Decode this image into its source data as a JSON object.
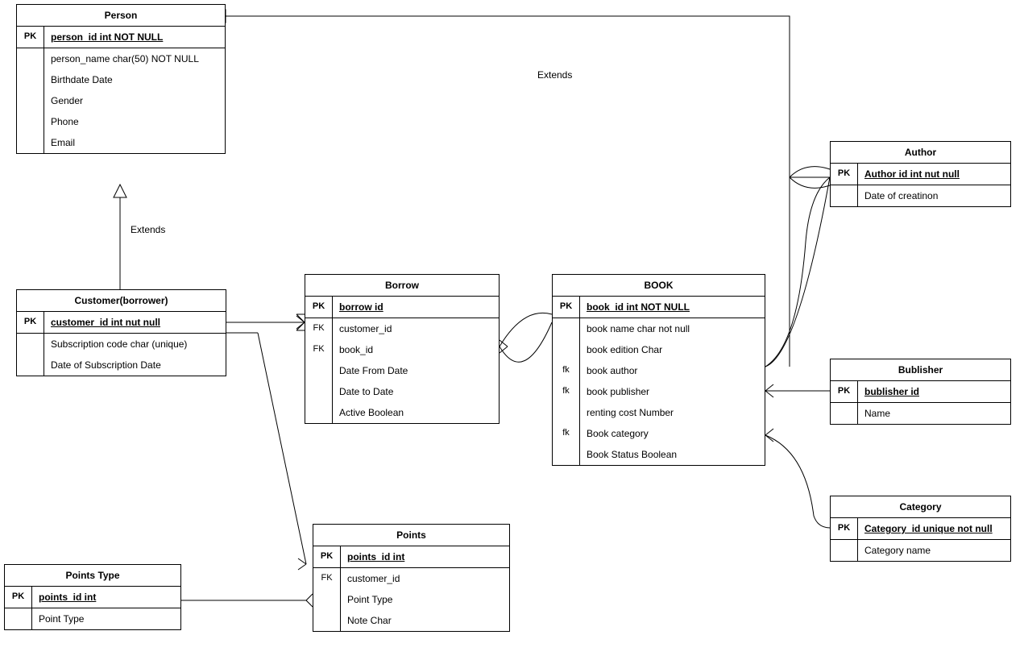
{
  "labels": {
    "extends1": "Extends",
    "extends2": "Extends"
  },
  "entities": {
    "person": {
      "title": "Person",
      "pk": "person_id int NOT NULL",
      "attrs": [
        "person_name char(50) NOT NULL",
        "Birthdate Date",
        "Gender",
        "Phone",
        "Email"
      ]
    },
    "customer": {
      "title": "Customer(borrower)",
      "pk": "customer_id int nut null",
      "attrs": [
        "Subscription code char (unique)",
        "Date of Subscription Date"
      ]
    },
    "borrow": {
      "title": "Borrow",
      "rows": [
        {
          "key": "PK",
          "text": "borrow id",
          "pk": true
        },
        {
          "key": "FK",
          "text": "customer_id"
        },
        {
          "key": "FK",
          "text": "book_id"
        },
        {
          "key": "",
          "text": "Date From  Date"
        },
        {
          "key": "",
          "text": "Date to    Date"
        },
        {
          "key": "",
          "text": "Active  Boolean"
        }
      ]
    },
    "book": {
      "title": "BOOK",
      "rows": [
        {
          "key": "PK",
          "text": "book_id int NOT NULL",
          "pk": true
        },
        {
          "key": "",
          "text": "book name char not null"
        },
        {
          "key": "",
          "text": "book edition Char"
        },
        {
          "key": "fk",
          "text": "book author"
        },
        {
          "key": "fk",
          "text": "book publisher"
        },
        {
          "key": "",
          "text": "renting cost  Number"
        },
        {
          "key": "fk",
          "text": "Book category"
        },
        {
          "key": "",
          "text": "Book Status Boolean"
        }
      ]
    },
    "author": {
      "title": "Author",
      "pk": "Author id  int nut null",
      "attrs": [
        "Date of  creatinon"
      ]
    },
    "publisher": {
      "title": "Bublisher",
      "pk": "bublisher id",
      "attrs": [
        "Name"
      ]
    },
    "category": {
      "title": "Category",
      "pk": "Category_id unique not null",
      "attrs": [
        "Category name"
      ]
    },
    "points": {
      "title": "Points",
      "rows": [
        {
          "key": "PK",
          "text": "points_id int",
          "pk": true
        },
        {
          "key": "FK",
          "text": "customer_id"
        },
        {
          "key": "",
          "text": "Point Type"
        },
        {
          "key": "",
          "text": "Note Char"
        }
      ]
    },
    "pointsType": {
      "title": "Points Type",
      "pk": "points_id int",
      "attrs": [
        "Point Type"
      ]
    }
  }
}
